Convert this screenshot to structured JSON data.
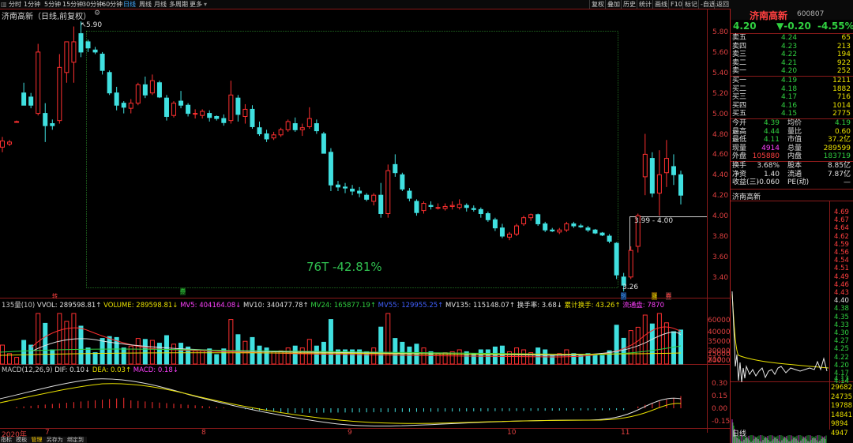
{
  "toolbar": {
    "items": [
      "分时",
      "1分钟",
      "5分钟",
      "15分钟",
      "30分钟",
      "60分钟",
      "日线",
      "周线",
      "月线",
      "多周期",
      "更多"
    ],
    "active": "日线",
    "right_buttons": [
      "复权",
      "叠加",
      "历史",
      "统计",
      "画线",
      "F10",
      "标记",
      "-自选",
      "返回"
    ]
  },
  "chart": {
    "title": "济南高新（日线,前复权）",
    "price_ticks": [
      "5.80",
      "5.60",
      "5.40",
      "5.20",
      "5.00",
      "4.80",
      "4.60",
      "4.40",
      "4.20",
      "4.00",
      "3.80",
      "3.60",
      "3.40"
    ],
    "high_label": "5.90",
    "low_label": "3.26",
    "range_label": "3.99 - 4.00",
    "measure_label": "76T -42.81%",
    "vol_ticks": [
      "60000",
      "40000",
      "35000",
      "30000",
      "20000",
      "15000",
      "X10"
    ],
    "macd_ticks": [
      "0.30",
      "0.15",
      "0.00",
      "-0.15"
    ],
    "date_labels": [
      "2020年",
      "7",
      "8",
      "9",
      "10",
      "11"
    ],
    "markers": [
      "转",
      "券",
      "别",
      "涨",
      "券"
    ],
    "colors": {
      "up": "#ff3030",
      "down": "#40e0e0",
      "ma_white": "#e0e0e0",
      "ma_yellow": "#e8e000"
    }
  },
  "vol_line": [
    {
      "t": "135量(10) ",
      "c": "#c8c8c8"
    },
    {
      "t": "VVOL: 289598.81↑ ",
      "c": "#e0e0e0"
    },
    {
      "t": "VOLUME: 289598.81↓ ",
      "c": "#e8e000"
    },
    {
      "t": "MV5: 404164.08↓ ",
      "c": "#ff40ff"
    },
    {
      "t": "MV10: 340477.78↑ ",
      "c": "#e0e0e0"
    },
    {
      "t": "MV24: 165877.19↑ ",
      "c": "#30d040"
    },
    {
      "t": "MV55: 129955.25↑ ",
      "c": "#4060ff"
    },
    {
      "t": "MV135: 115148.07↑ ",
      "c": "#e0e0e0"
    },
    {
      "t": "换手率: 3.68↓ ",
      "c": "#e0e0e0"
    },
    {
      "t": "累计换手: 43.26↑ ",
      "c": "#e8e000"
    },
    {
      "t": "流通盘: 7870",
      "c": "#ff40ff"
    }
  ],
  "macd_line": [
    {
      "t": "MACD(12,26,9) ",
      "c": "#c8c8c8"
    },
    {
      "t": "DIF: 0.10↓ ",
      "c": "#e0e0e0"
    },
    {
      "t": "DEA: 0.03↑ ",
      "c": "#e8e000"
    },
    {
      "t": "MACD: 0.18↓",
      "c": "#ff40ff"
    }
  ],
  "bottom_tabs": [
    "指标",
    "模板",
    "管理",
    "另存为",
    "绑定到"
  ],
  "quote": {
    "name": "济南高新",
    "code": "600807",
    "price": "4.20",
    "change": "▼-0.20",
    "pct": "-4.55%",
    "asks": [
      {
        "label": "卖五",
        "price": "4.24",
        "vol": "65"
      },
      {
        "label": "卖四",
        "price": "4.23",
        "vol": "213"
      },
      {
        "label": "卖三",
        "price": "4.22",
        "vol": "194"
      },
      {
        "label": "卖二",
        "price": "4.21",
        "vol": "922"
      },
      {
        "label": "卖一",
        "price": "4.20",
        "vol": "252"
      }
    ],
    "bids": [
      {
        "label": "买一",
        "price": "4.19",
        "vol": "1211"
      },
      {
        "label": "买二",
        "price": "4.18",
        "vol": "1882"
      },
      {
        "label": "买三",
        "price": "4.17",
        "vol": "716"
      },
      {
        "label": "买四",
        "price": "4.16",
        "vol": "1014"
      },
      {
        "label": "买五",
        "price": "4.15",
        "vol": "2775"
      }
    ],
    "stats": [
      {
        "l1": "今开",
        "v1": "4.39",
        "c1": "#30d040",
        "l2": "均价",
        "v2": "4.19",
        "c2": "#30d040"
      },
      {
        "l1": "最高",
        "v1": "4.44",
        "c1": "#30d040",
        "l2": "量比",
        "v2": "0.60",
        "c2": "#e8e000"
      },
      {
        "l1": "最低",
        "v1": "4.11",
        "c1": "#30d040",
        "l2": "市值",
        "v2": "37.2亿",
        "c2": "#e8e000"
      },
      {
        "l1": "现量",
        "v1": "4914",
        "c1": "#ff40ff",
        "l2": "总量",
        "v2": "289599",
        "c2": "#e8e000"
      },
      {
        "l1": "外盘",
        "v1": "105880",
        "c1": "#ff4040",
        "l2": "内盘",
        "v2": "183719",
        "c2": "#30d040"
      }
    ],
    "stats2": [
      {
        "l1": "换手",
        "v1": "3.68%",
        "l2": "股本",
        "v2": "8.85亿"
      },
      {
        "l1": "净资",
        "v1": "1.40",
        "l2": "流通",
        "v2": "7.87亿"
      },
      {
        "l1": "收益(三)",
        "v1": "-0.060",
        "l2": "PE(动)",
        "v2": "—"
      }
    ]
  },
  "minichart": {
    "title": "济南高新",
    "price_ticks": [
      "4.69",
      "4.67",
      "4.64",
      "4.62",
      "4.59",
      "4.56",
      "4.54",
      "4.51",
      "4.49",
      "4.46",
      "4.43",
      "4.40",
      "4.38",
      "4.35",
      "4.33",
      "4.30",
      "4.27",
      "4.25",
      "4.22",
      "4.20",
      "4.17",
      "4.14"
    ],
    "ticks_tail": [
      "4.13"
    ],
    "vol_ticks": [
      "29682",
      "24735",
      "19788",
      "14841",
      "9894",
      "4947"
    ],
    "tab": "日线"
  }
}
